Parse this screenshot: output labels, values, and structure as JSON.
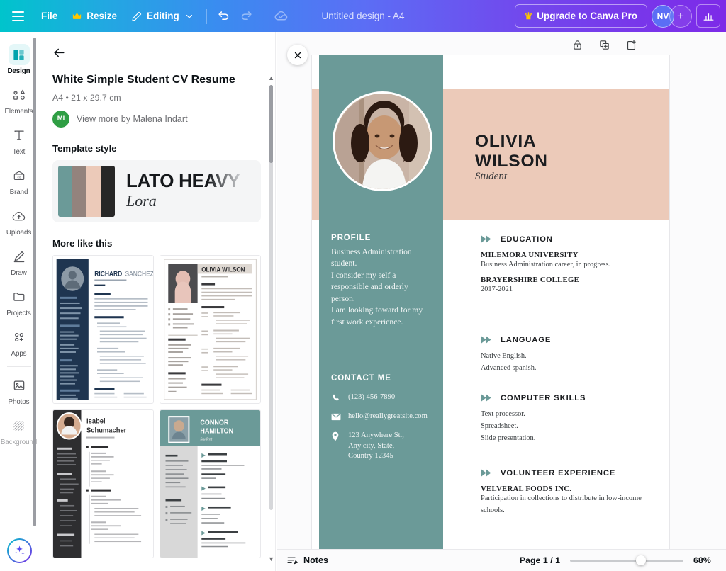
{
  "topbar": {
    "menu_icon": "hamburger-icon",
    "file_label": "File",
    "resize_label": "Resize",
    "resize_icon": "crown-icon",
    "editing_label": "Editing",
    "editing_icon": "pencil-icon",
    "editing_caret": "chevron-down-icon",
    "undo_icon": "undo-arrow-icon",
    "redo_icon": "redo-arrow-icon",
    "saved_icon": "cloud-check-icon",
    "design_title": "Untitled design - A4",
    "upgrade_label": "Upgrade to Canva Pro",
    "upgrade_icon": "crown-icon",
    "avatar_initials": "NV",
    "add_member_icon": "plus-icon",
    "insights_icon": "bar-chart-icon"
  },
  "rail": {
    "items": [
      {
        "label": "Design",
        "icon": "design-panels-icon",
        "active": true
      },
      {
        "label": "Elements",
        "icon": "shapes-icon",
        "active": false
      },
      {
        "label": "Text",
        "icon": "text-T-icon",
        "active": false
      },
      {
        "label": "Brand",
        "icon": "brand-box-icon",
        "active": false
      },
      {
        "label": "Uploads",
        "icon": "cloud-upload-icon",
        "active": false
      },
      {
        "label": "Draw",
        "icon": "pen-draw-icon",
        "active": false
      },
      {
        "label": "Projects",
        "icon": "folder-icon",
        "active": false
      },
      {
        "label": "Apps",
        "icon": "apps-grid-plus-icon",
        "active": false
      },
      {
        "label": "Photos",
        "icon": "photo-image-icon",
        "active": false
      },
      {
        "label": "Background",
        "icon": "background-pattern-icon",
        "active": false
      }
    ],
    "magic_button_icon": "magic-sparkle-icon"
  },
  "panel": {
    "back_icon": "arrow-left-icon",
    "template_title": "White Simple Student CV Resume",
    "template_size": "A4 • 21 x 29.7 cm",
    "author_initials": "MI",
    "author_label": "View more by Malena Indart",
    "template_style_heading": "Template style",
    "style_card": {
      "font_heading": "LATO HEAVY",
      "font_body": "Lora",
      "swatches": [
        "#6b9a98",
        "#93837d",
        "#eccab9",
        "#272727"
      ]
    },
    "more_like_this_heading": "More like this",
    "thumbnails": [
      {
        "name": "RICHARD SANCHEZ",
        "role": "Marketing Manager",
        "theme": "navy"
      },
      {
        "name": "OLIVIA WILSON",
        "role": "Graphic Designer",
        "theme": "beige"
      },
      {
        "name": "Isabel Schumacher",
        "role": "Graphic Designer",
        "theme": "dark"
      },
      {
        "name": "CONNOR HAMILTON",
        "role": "Student",
        "theme": "teal"
      }
    ]
  },
  "canvas": {
    "close_icon": "close-x-icon",
    "page_tools": [
      {
        "name": "lock-page-icon",
        "title": "Lock"
      },
      {
        "name": "duplicate-page-icon",
        "title": "Duplicate page"
      },
      {
        "name": "add-page-icon",
        "title": "Add page"
      }
    ],
    "colors": {
      "teal": "#6b9a98",
      "peach": "#eccab9",
      "ink": "#1b1d20"
    }
  },
  "resume": {
    "name": "OLIVIA\nWILSON",
    "name_line1": "OLIVIA",
    "name_line2": "WILSON",
    "role": "Student",
    "profile": {
      "heading": "PROFILE",
      "body": "Business Administration student.\nI consider my self a responsible and orderly person.\nI am looking foward for my first work experience."
    },
    "contact": {
      "heading": "CONTACT ME",
      "items": [
        {
          "icon": "phone-icon",
          "text": "(123) 456-7890"
        },
        {
          "icon": "envelope-icon",
          "text": "hello@reallygreatsite.com"
        },
        {
          "icon": "map-pin-icon",
          "text": "123 Anywhere St.,\nAny city, State,\nCountry 12345"
        }
      ]
    },
    "sections": [
      {
        "heading": "EDUCATION",
        "entries": [
          {
            "title": "MILEMORA UNIVERSITY",
            "text": "Business Administration career, in progress."
          },
          {
            "title": "BRAYERSHIRE COLLEGE",
            "text": "2017-2021"
          }
        ]
      },
      {
        "heading": "LANGUAGE",
        "entries": [
          {
            "title": "",
            "text": "Native English.\nAdvanced spanish."
          }
        ]
      },
      {
        "heading": "COMPUTER SKILLS",
        "entries": [
          {
            "title": "",
            "text": "Text processor.\nSpreadsheet.\nSlide presentation."
          }
        ]
      },
      {
        "heading": "VOLUNTEER EXPERIENCE",
        "entries": [
          {
            "title": "VELVERAL FOODS INC.",
            "text": "Participation in collections to distribute in low-income schools."
          }
        ]
      }
    ]
  },
  "bottombar": {
    "notes_label": "Notes",
    "notes_icon": "notes-lines-icon",
    "page_indicator": "Page 1 / 1",
    "zoom_level": "68%",
    "zoom_value": 68
  }
}
